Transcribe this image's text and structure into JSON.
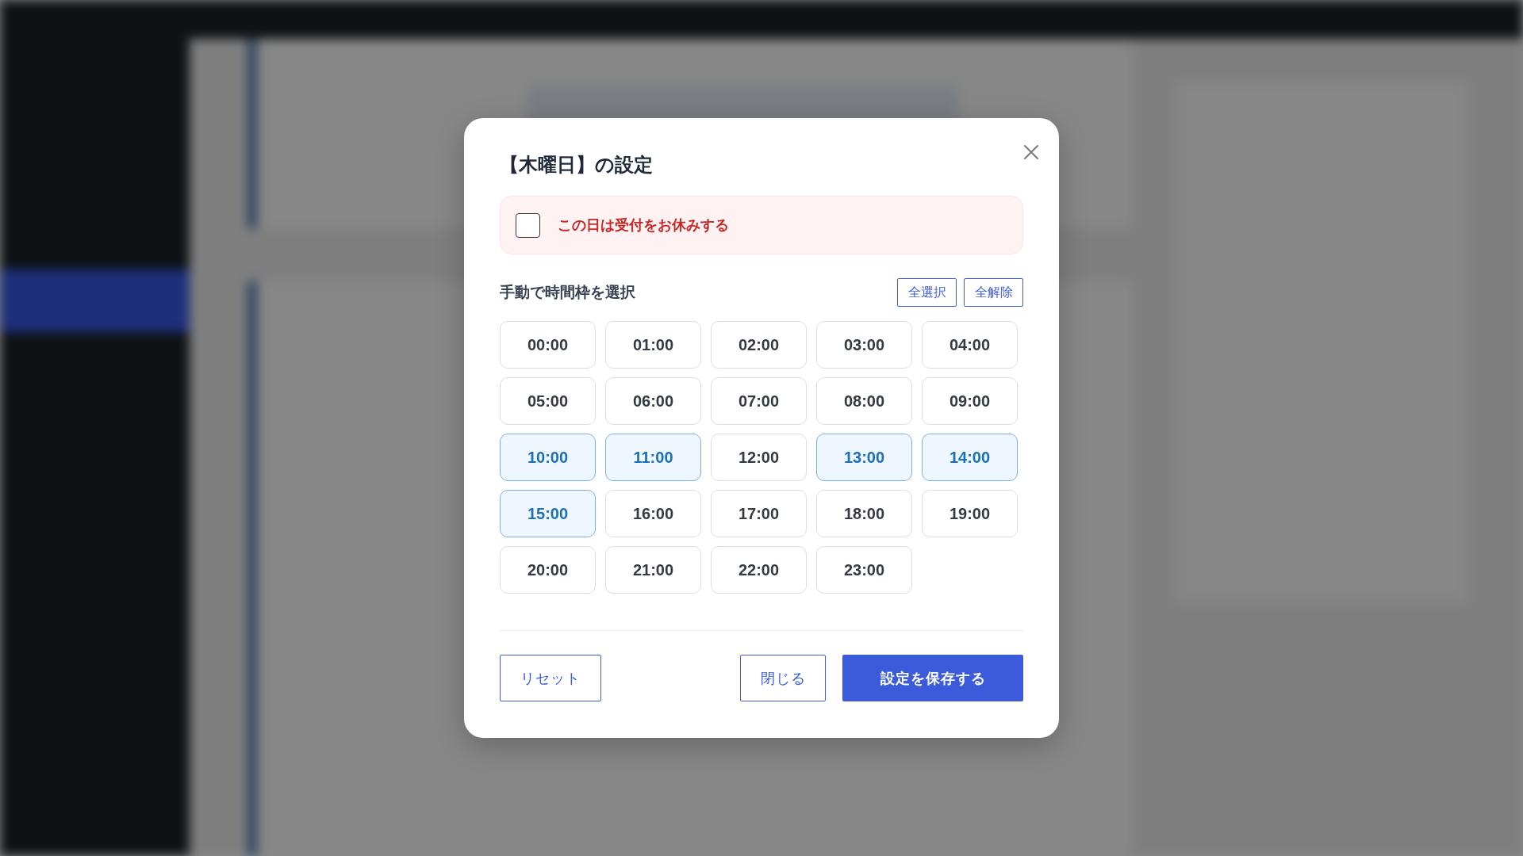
{
  "dialog": {
    "title": "【木曜日】の設定",
    "closed_day": {
      "label": "この日は受付をお休みする",
      "checked": false
    },
    "manual_section": {
      "heading": "手動で時間枠を選択",
      "actions": [
        {
          "label": "全選択"
        },
        {
          "label": "全解除"
        }
      ]
    },
    "time_slots": [
      {
        "label": "00:00",
        "selected": false
      },
      {
        "label": "01:00",
        "selected": false
      },
      {
        "label": "02:00",
        "selected": false
      },
      {
        "label": "03:00",
        "selected": false
      },
      {
        "label": "04:00",
        "selected": false
      },
      {
        "label": "05:00",
        "selected": false
      },
      {
        "label": "06:00",
        "selected": false
      },
      {
        "label": "07:00",
        "selected": false
      },
      {
        "label": "08:00",
        "selected": false
      },
      {
        "label": "09:00",
        "selected": false
      },
      {
        "label": "10:00",
        "selected": true
      },
      {
        "label": "11:00",
        "selected": true
      },
      {
        "label": "12:00",
        "selected": false
      },
      {
        "label": "13:00",
        "selected": true
      },
      {
        "label": "14:00",
        "selected": true
      },
      {
        "label": "15:00",
        "selected": true
      },
      {
        "label": "16:00",
        "selected": false
      },
      {
        "label": "17:00",
        "selected": false
      },
      {
        "label": "18:00",
        "selected": false
      },
      {
        "label": "19:00",
        "selected": false
      },
      {
        "label": "20:00",
        "selected": false
      },
      {
        "label": "21:00",
        "selected": false
      },
      {
        "label": "22:00",
        "selected": false
      },
      {
        "label": "23:00",
        "selected": false
      }
    ],
    "footer": {
      "reset_button": "リセット",
      "close_button": "閉じる",
      "save_button": "設定を保存する"
    }
  }
}
